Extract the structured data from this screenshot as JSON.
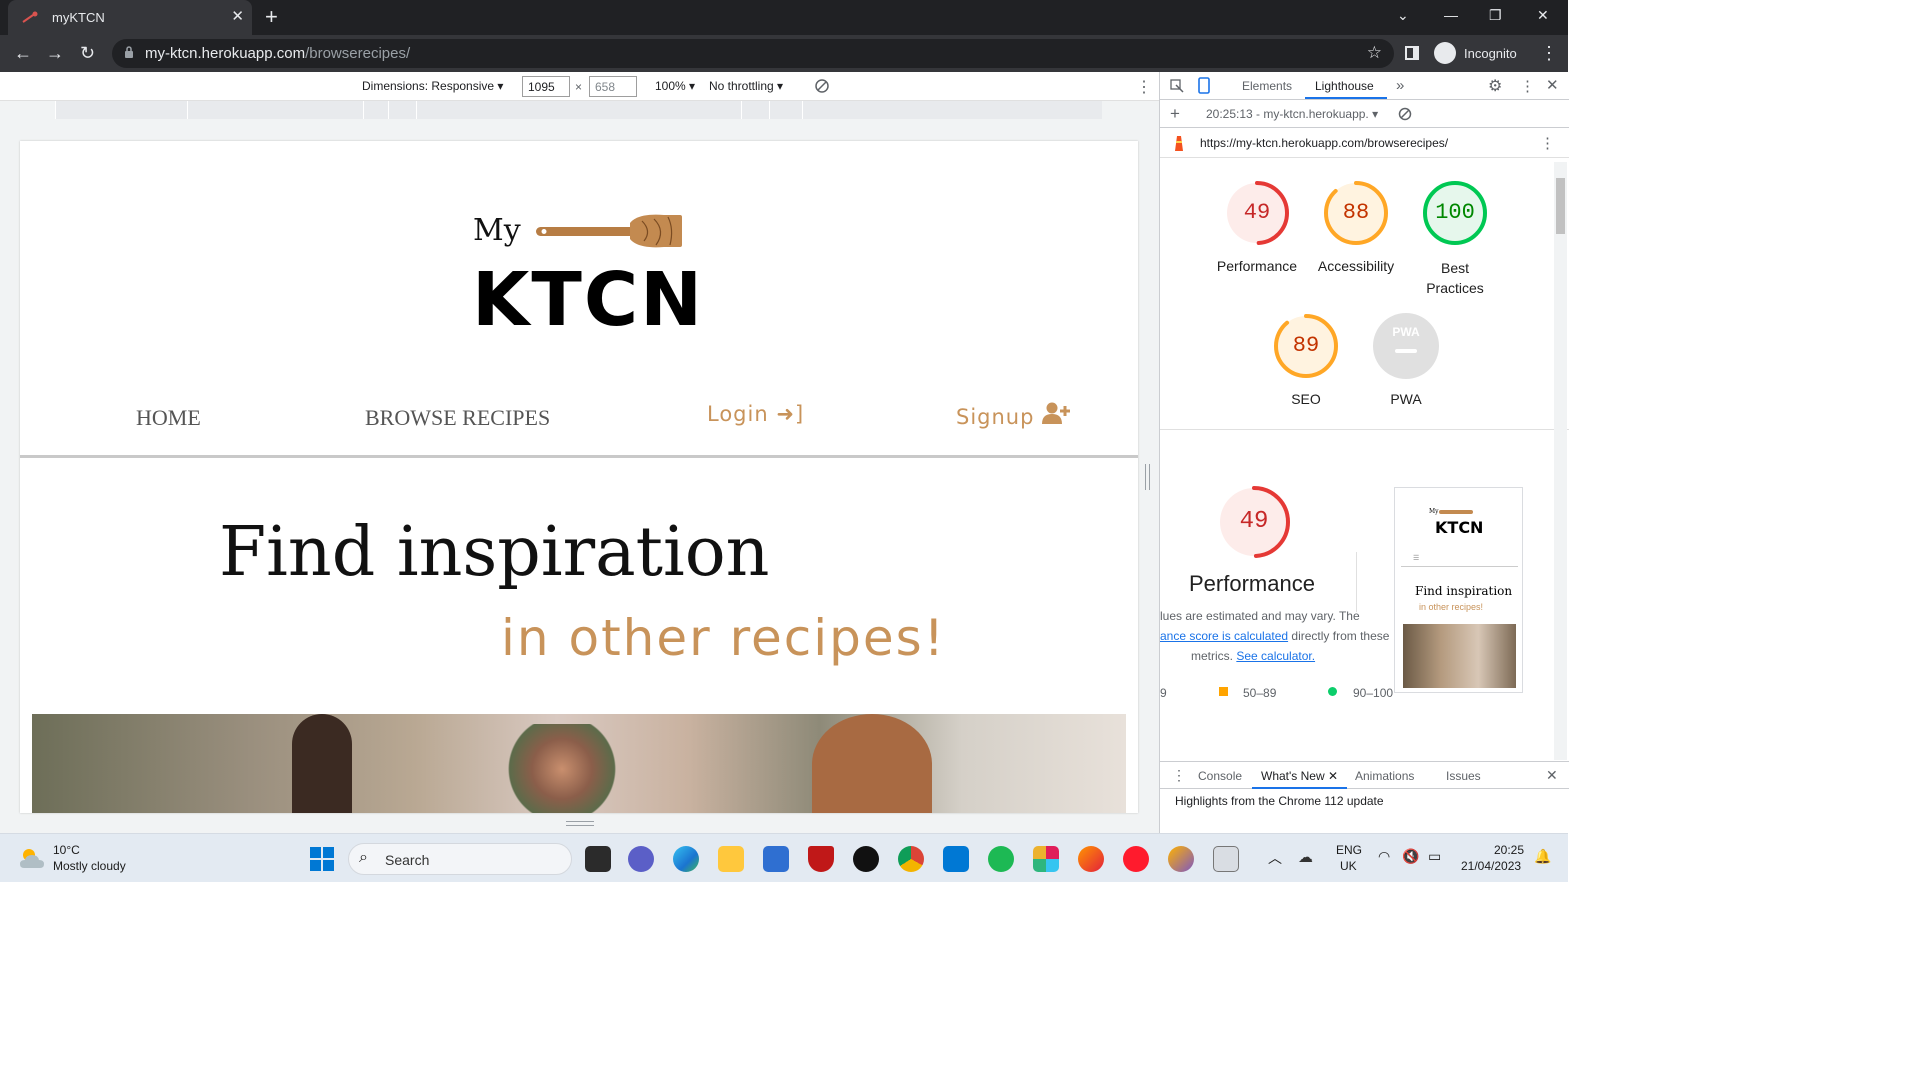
{
  "browser": {
    "tab_title": "myKTCN",
    "tab_close": "✕",
    "new_tab": "+",
    "url_host": "my-ktcn.herokuapp.com",
    "url_path": "/browserecipes/",
    "profile": "Incognito",
    "window_controls": {
      "dropdown": "⌄",
      "minimize": "—",
      "restore": "❐",
      "close": "✕"
    }
  },
  "device_toolbar": {
    "dimensions_label": "Dimensions: Responsive",
    "width": "1095",
    "times": "×",
    "height": "658",
    "zoom": "100%",
    "throttling": "No throttling"
  },
  "site": {
    "logo_my": "My",
    "logo_ktcn": "KTCN",
    "nav": {
      "home": "HOME",
      "browse": "BROWSE RECIPES",
      "login": "Login",
      "signup": "Signup"
    },
    "hero_title": "Find inspiration",
    "hero_subtitle": "in other recipes!"
  },
  "devtools": {
    "tabs": {
      "elements": "Elements",
      "lighthouse": "Lighthouse",
      "more": "»"
    },
    "report_select": "20:25:13 - my-ktcn.herokuapp.",
    "report_url": "https://my-ktcn.herokuapp.com/browserecipes/",
    "scores": [
      {
        "value": "49",
        "label": "Performance",
        "score": 49,
        "color": "#e53935",
        "bg": "#fdecea",
        "text": "#c62828"
      },
      {
        "value": "88",
        "label": "Accessibility",
        "score": 88,
        "color": "#ffa726",
        "bg": "#fff3e0",
        "text": "#c33300"
      },
      {
        "value": "100",
        "label": "Best Practices",
        "score": 100,
        "color": "#00c853",
        "bg": "#e6f7ec",
        "text": "#008800"
      },
      {
        "value": "89",
        "label": "SEO",
        "score": 89,
        "color": "#ffa726",
        "bg": "#fff3e0",
        "text": "#c33300"
      }
    ],
    "pwa_label": "PWA",
    "pwa_badge": "PWA",
    "perf_detail": {
      "score": "49",
      "title": "Performance",
      "line1": "lues are estimated and may vary. The",
      "line2_link": "ance score is calculated",
      "line2_rest": " directly from these",
      "line3": "metrics.",
      "line3_link": "See calculator.",
      "legend": [
        "9",
        "50–89",
        "90–100"
      ]
    },
    "thumb": {
      "my": "My",
      "ktcn": "KTCN",
      "title": "Find inspiration",
      "subtitle": "in other recipes!"
    },
    "drawer_tabs": {
      "console": "Console",
      "whatsnew": "What's New",
      "animations": "Animations",
      "issues": "Issues"
    },
    "drawer_text": "Highlights from the Chrome 112 update"
  },
  "taskbar": {
    "weather_temp": "10°C",
    "weather_desc": "Mostly cloudy",
    "search": "Search",
    "lang": "ENG",
    "region": "UK",
    "time": "20:25",
    "date": "21/04/2023"
  }
}
